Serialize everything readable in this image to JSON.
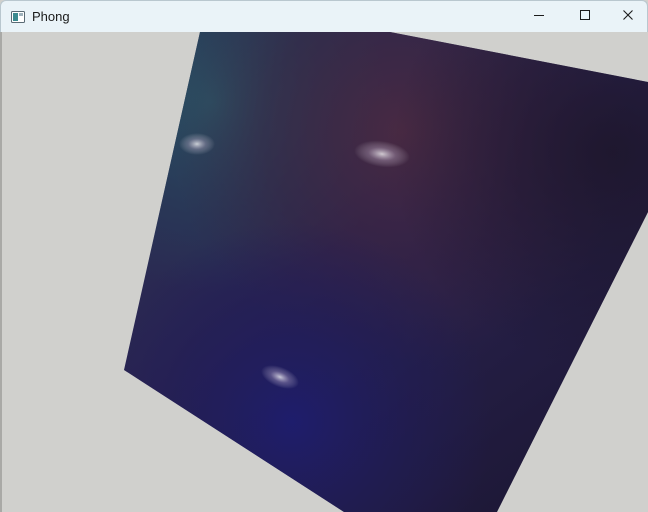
{
  "window": {
    "title": "Phong",
    "controls": {
      "minimize": "minimize-icon",
      "maximize": "maximize-icon",
      "close": "close-icon"
    }
  },
  "scene": {
    "background_color": "#d0d0cd",
    "surface_colors": {
      "dark_purple": "#231a34",
      "teal": "#29485a",
      "maroon": "#46283c",
      "navy": "#1c1a5e"
    },
    "highlights": 3
  }
}
